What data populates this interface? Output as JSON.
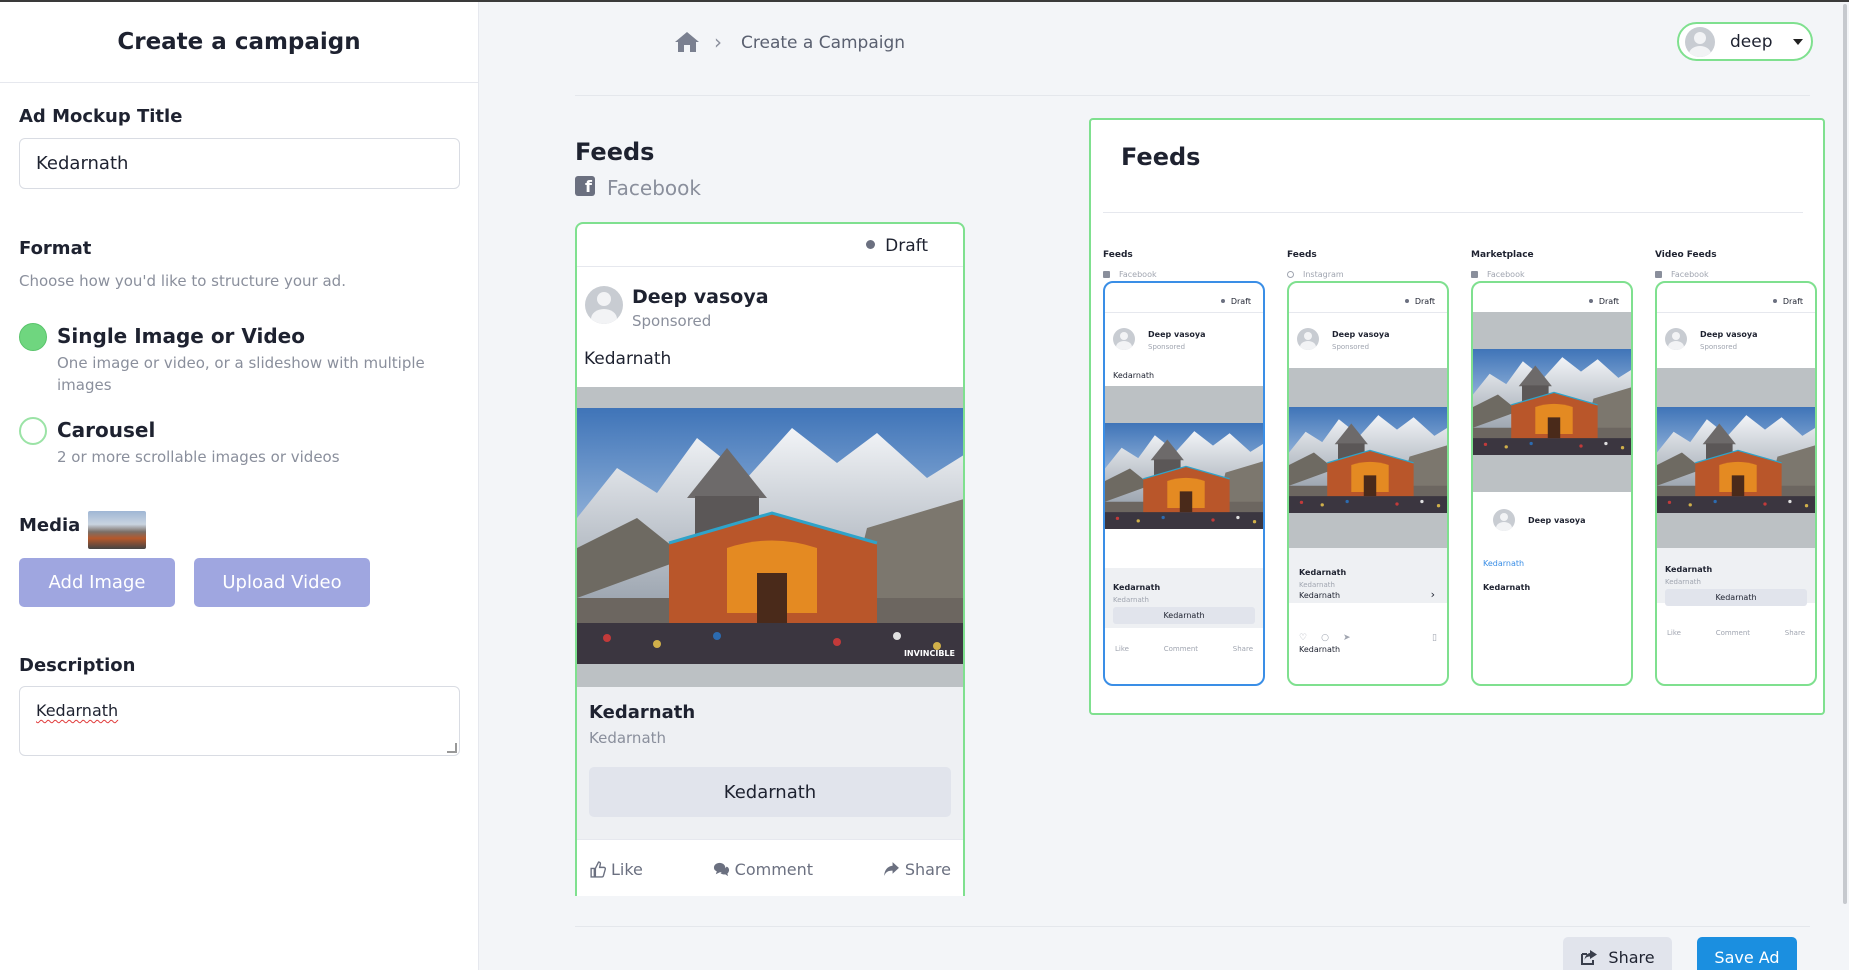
{
  "sidebar": {
    "title": "Create a campaign",
    "ad_title_label": "Ad Mockup Title",
    "ad_title_value": "Kedarnath",
    "format_label": "Format",
    "format_hint": "Choose how you'd like to structure your ad.",
    "options": [
      {
        "title": "Single Image or Video",
        "sub": "One image or video, or a slideshow with multiple images",
        "selected": true
      },
      {
        "title": "Carousel",
        "sub": "2 or more scrollable images or videos",
        "selected": false
      }
    ],
    "media_label": "Media",
    "add_image": "Add Image",
    "upload_video": "Upload Video",
    "description_label": "Description",
    "description_value": "Kedarnath"
  },
  "header": {
    "breadcrumb": "Create a Campaign",
    "user": "deep"
  },
  "preview": {
    "title": "Feeds",
    "platform": "Facebook",
    "status": "Draft",
    "page_name": "Deep vasoya",
    "sponsored": "Sponsored",
    "primary_text": "Kedarnath",
    "headline": "Kedarnath",
    "description": "Kedarnath",
    "cta": "Kedarnath",
    "image_watermark": "INVINCIBLE",
    "actions": {
      "like": "Like",
      "comment": "Comment",
      "share": "Share"
    }
  },
  "placements": {
    "title": "Feeds",
    "items": [
      {
        "heading": "Feeds",
        "platform": "Facebook"
      },
      {
        "heading": "Feeds",
        "platform": "Instagram"
      },
      {
        "heading": "Marketplace",
        "platform": "Facebook"
      },
      {
        "heading": "Video Feeds",
        "platform": "Facebook"
      }
    ]
  },
  "footer": {
    "share": "Share",
    "save": "Save Ad"
  },
  "colors": {
    "accent_green": "#7fe08f",
    "primary_blue": "#1b8fe0",
    "purple_button": "#9fa6e0"
  }
}
